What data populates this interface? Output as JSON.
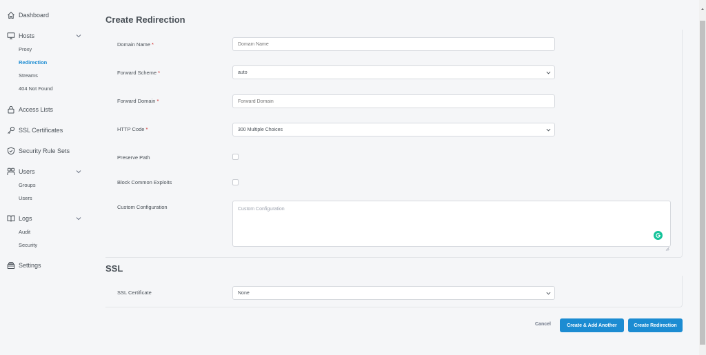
{
  "sidebar": {
    "dashboard": "Dashboard",
    "hosts": "Hosts",
    "hosts_items": [
      "Proxy",
      "Redirection",
      "Streams",
      "404 Not Found"
    ],
    "access_lists": "Access Lists",
    "ssl_certificates": "SSL Certificates",
    "security_rule_sets": "Security Rule Sets",
    "users": "Users",
    "users_items": [
      "Groups",
      "Users"
    ],
    "logs": "Logs",
    "logs_items": [
      "Audit",
      "Security"
    ],
    "settings": "Settings",
    "active_item": "Redirection"
  },
  "form": {
    "title": "Create Redirection",
    "required_mark": "*",
    "domain_name": {
      "label": "Domain Name",
      "placeholder": "Domain Name",
      "value": ""
    },
    "forward_scheme": {
      "label": "Forward Scheme",
      "value": "auto"
    },
    "forward_domain": {
      "label": "Forward Domain",
      "placeholder": "Forward Domain",
      "value": ""
    },
    "http_code": {
      "label": "HTTP Code",
      "value": "300 Multiple Choices"
    },
    "preserve_path": {
      "label": "Preserve Path",
      "checked": false
    },
    "block_common_exploits": {
      "label": "Block Common Exploits",
      "checked": false
    },
    "custom_configuration": {
      "label": "Custom Configuration",
      "placeholder": "Custom Configuration"
    }
  },
  "ssl": {
    "title": "SSL",
    "certificate": {
      "label": "SSL Certificate",
      "value": "None"
    }
  },
  "actions": {
    "cancel": "Cancel",
    "create_add_another": "Create & Add Another",
    "create": "Create Redirection"
  },
  "colors": {
    "accent": "#1c8cd2",
    "required": "#cd201f",
    "grammarly": "#15c39a"
  }
}
